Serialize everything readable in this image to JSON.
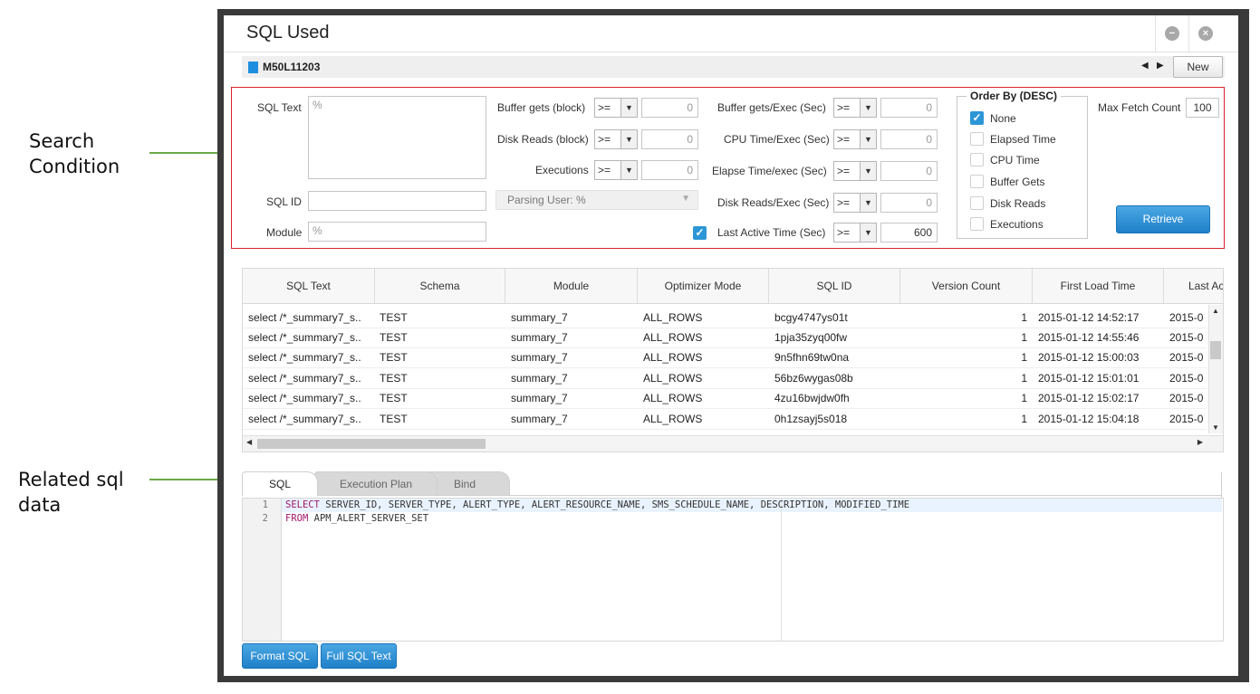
{
  "annotations": {
    "search": [
      "Search",
      "Condition"
    ],
    "related": [
      "Related sql",
      "data"
    ]
  },
  "window": {
    "title": "SQL Used",
    "instance": "M50L11203",
    "new_label": "New"
  },
  "search": {
    "sql_text_label": "SQL Text",
    "sql_text_placeholder": "%",
    "sql_id_label": "SQL ID",
    "sql_id_value": "",
    "module_label": "Module",
    "module_placeholder": "%",
    "buffer_gets_label": "Buffer gets (block)",
    "buffer_gets_op": ">=",
    "buffer_gets_value": "0",
    "disk_reads_label": "Disk Reads (block)",
    "disk_reads_op": ">=",
    "disk_reads_value": "0",
    "executions_label": "Executions",
    "executions_op": ">=",
    "executions_value": "0",
    "parsing_user": "Parsing User: %",
    "bg_exec_label": "Buffer gets/Exec (Sec)",
    "bg_exec_op": ">=",
    "bg_exec_value": "0",
    "cpu_exec_label": "CPU Time/Exec (Sec)",
    "cpu_exec_op": ">=",
    "cpu_exec_value": "0",
    "elapse_exec_label": "Elapse Time/exec (Sec)",
    "elapse_exec_op": ">=",
    "elapse_exec_value": "0",
    "dr_exec_label": "Disk Reads/Exec (Sec)",
    "dr_exec_op": ">=",
    "dr_exec_value": "0",
    "last_active_label": "Last Active Time (Sec)",
    "last_active_op": ">=",
    "last_active_value": "600",
    "last_active_checked": true,
    "order_by_title": "Order By (DESC)",
    "order_by": [
      {
        "label": "None",
        "checked": true
      },
      {
        "label": "Elapsed Time",
        "checked": false
      },
      {
        "label": "CPU Time",
        "checked": false
      },
      {
        "label": "Buffer Gets",
        "checked": false
      },
      {
        "label": "Disk Reads",
        "checked": false
      },
      {
        "label": "Executions",
        "checked": false
      }
    ],
    "max_fetch_label": "Max Fetch Count",
    "max_fetch_value": "100",
    "retrieve_label": "Retrieve"
  },
  "grid": {
    "columns": [
      "SQL Text",
      "Schema",
      "Module",
      "Optimizer Mode",
      "SQL ID",
      "Version Count",
      "First Load Time",
      "Last Ac"
    ],
    "rows": [
      [
        "select /*_summary7_s..",
        "TEST",
        "summary_7",
        "ALL_ROWS",
        "bcgy4747ys01t",
        "1",
        "2015-01-12 14:52:17",
        "2015-0"
      ],
      [
        "select /*_summary7_s..",
        "TEST",
        "summary_7",
        "ALL_ROWS",
        "1pja35zyq00fw",
        "1",
        "2015-01-12 14:55:46",
        "2015-0"
      ],
      [
        "select /*_summary7_s..",
        "TEST",
        "summary_7",
        "ALL_ROWS",
        "9n5fhn69tw0na",
        "1",
        "2015-01-12 15:00:03",
        "2015-0"
      ],
      [
        "select /*_summary7_s..",
        "TEST",
        "summary_7",
        "ALL_ROWS",
        "56bz6wygas08b",
        "1",
        "2015-01-12 15:01:01",
        "2015-0"
      ],
      [
        "select /*_summary7_s..",
        "TEST",
        "summary_7",
        "ALL_ROWS",
        "4zu16bwjdw0fh",
        "1",
        "2015-01-12 15:02:17",
        "2015-0"
      ],
      [
        "select /*_summary7_s..",
        "TEST",
        "summary_7",
        "ALL_ROWS",
        "0h1zsayj5s018",
        "1",
        "2015-01-12 15:04:18",
        "2015-0"
      ]
    ]
  },
  "tabs": [
    "SQL",
    "Execution Plan",
    "Bind"
  ],
  "editor": {
    "lines": [
      {
        "num": "1",
        "kw": "SELECT",
        "rest": " SERVER_ID, SERVER_TYPE, ALERT_TYPE, ALERT_RESOURCE_NAME, SMS_SCHEDULE_NAME, DESCRIPTION, MODIFIED_TIME"
      },
      {
        "num": "2",
        "kw": "FROM",
        "rest": " APM_ALERT_SERVER_SET"
      }
    ]
  },
  "buttons": {
    "format_sql": "Format SQL",
    "full_sql_text": "Full SQL Text"
  },
  "colors": {
    "accent": "#1f80c9",
    "search_border": "#d9222a",
    "arrow": "#6aa846"
  }
}
